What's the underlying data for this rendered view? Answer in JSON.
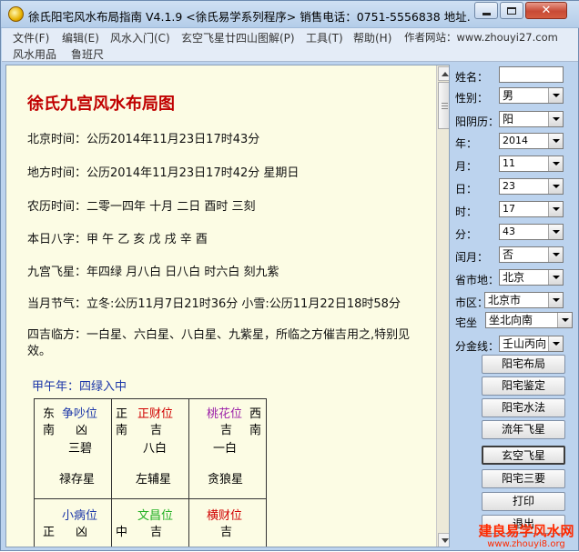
{
  "window": {
    "title": "徐氏阳宅风水布局指南 V4.1.9 <徐氏易学系列程序> 销售电话：0751-5556838 地址..."
  },
  "menu": [
    "文件(F)",
    "编辑(E)",
    "风水入门(C)",
    "玄空飞星廿四山图解(P)",
    "工具(T)",
    "帮助(H)",
    "作者网站：www.zhouyi27.com"
  ],
  "toolbar2": [
    "风水用品",
    "鲁班尺"
  ],
  "document": {
    "title": "徐氏九宫风水布局图",
    "lines": [
      "北京时间：公历2014年11月23日17时43分",
      "地方时间：公历2014年11月23日17时42分   星期日",
      "农历时间：二零一四年  十月  二日  酉时  三刻",
      "本日八字：甲 午     乙 亥     戊 戌     辛 酉",
      "九宫飞星：年四绿    月八白    日八白    时六白    刻九紫",
      "当月节气：立冬:公历11月7日21时36分 小雪:公历11月22日18时58分",
      "四吉临方：一白星、六白星、八白星、九紫星，所临之方催吉用之,特别见效。"
    ],
    "year_star": "甲午年：四绿入中",
    "palaces": [
      {
        "dir_a": "东",
        "name": "争吵位",
        "dir_b": "南",
        "luck": "凶",
        "star": "三碧",
        "aux": "禄存星",
        "name_color": "#1a35a8"
      },
      {
        "dir_a": "正",
        "name": "正财位",
        "dir_b": "南",
        "luck": "吉",
        "star": "八白",
        "aux": "左辅星",
        "name_color": "#d00000"
      },
      {
        "dir_a": "西",
        "name": "桃花位",
        "dir_b": "南",
        "luck": "吉",
        "star": "一白",
        "aux": "贪狼星",
        "name_color": "#9b1fa8"
      }
    ],
    "palaces_row2": [
      {
        "dir_a": "正",
        "name": "小病位",
        "luck": "凶",
        "name_color": "#1a35a8"
      },
      {
        "dir_a": "中",
        "name": "文昌位",
        "luck": "吉",
        "name_color": "#22b022"
      },
      {
        "dir_a": "",
        "name": "横财位",
        "luck": "吉",
        "name_color": "#d00000"
      }
    ]
  },
  "side": {
    "name_label": "姓名：",
    "name_value": "",
    "fields": [
      {
        "label": "性别：",
        "value": "男"
      },
      {
        "label": "阳阴历：",
        "value": "阳"
      },
      {
        "label": "年：",
        "value": "2014"
      },
      {
        "label": "月：",
        "value": "11"
      },
      {
        "label": "日：",
        "value": "23"
      },
      {
        "label": "时：",
        "value": "17"
      },
      {
        "label": "分：",
        "value": "43"
      },
      {
        "label": "闰月：",
        "value": "否"
      },
      {
        "label": "省市地：",
        "value": "北京"
      },
      {
        "label": "市区：",
        "value": "北京市"
      },
      {
        "label": "宅坐",
        "value": "坐北向南"
      },
      {
        "label": "分金线：",
        "value": "壬山丙向"
      }
    ],
    "buttons": [
      "阳宅布局",
      "阳宅鉴定",
      "阳宅水法",
      "流年飞星",
      "玄空飞星",
      "阳宅三要",
      "打印",
      "退出"
    ]
  },
  "watermark": {
    "line1": "建良易学风水网",
    "line2": "www.zhouyi8.org"
  }
}
